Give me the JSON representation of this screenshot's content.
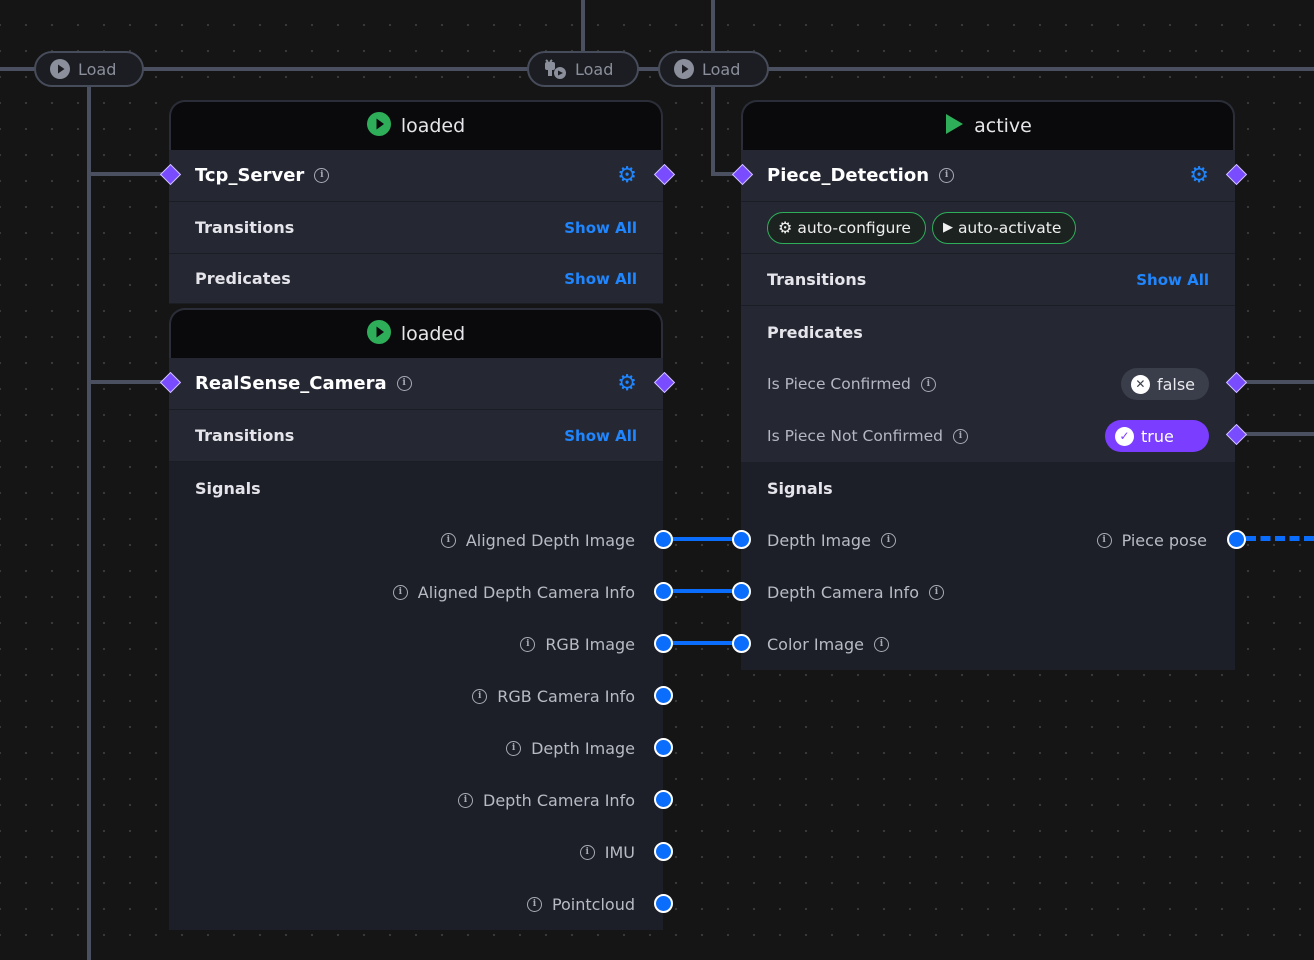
{
  "load_pills": [
    {
      "label": "Load",
      "icon": "play-circle-icon"
    },
    {
      "label": "Load",
      "icon": "plug-icon"
    },
    {
      "label": "Load",
      "icon": "play-circle-icon"
    }
  ],
  "nodes": {
    "tcp_server": {
      "status": "loaded",
      "status_icon": "play-circle-icon",
      "name": "Tcp_Server",
      "transitions_label": "Transitions",
      "transitions_action": "Show All",
      "predicates_label": "Predicates",
      "predicates_action": "Show All"
    },
    "realsense_camera": {
      "status": "loaded",
      "status_icon": "play-circle-icon",
      "name": "RealSense_Camera",
      "transitions_label": "Transitions",
      "transitions_action": "Show All",
      "signals_label": "Signals",
      "signals": [
        "Aligned Depth Image",
        "Aligned Depth Camera Info",
        "RGB Image",
        "RGB Camera Info",
        "Depth Image",
        "Depth Camera Info",
        "IMU",
        "Pointcloud"
      ]
    },
    "piece_detection": {
      "status": "active",
      "status_icon": "play-icon",
      "name": "Piece_Detection",
      "auto_configure": "auto-configure",
      "auto_activate": "auto-activate",
      "transitions_label": "Transitions",
      "transitions_action": "Show All",
      "predicates_label": "Predicates",
      "predicates": [
        {
          "label": "Is Piece Confirmed",
          "value": "false"
        },
        {
          "label": "Is Piece Not Confirmed",
          "value": "true"
        }
      ],
      "signals_label": "Signals",
      "input_signals": [
        "Depth Image",
        "Depth Camera Info",
        "Color Image"
      ],
      "output_signals": [
        "Piece pose"
      ]
    }
  },
  "colors": {
    "accent_blue": "#1f86ff",
    "port_purple": "#7a4cff",
    "status_green": "#2fae5a",
    "true_purple": "#7b3dff"
  }
}
